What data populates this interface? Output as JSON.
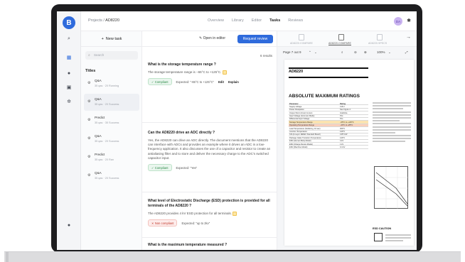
{
  "topbar": {
    "crumb_parent": "Projects",
    "crumb_sep": " / ",
    "crumb_current": "AD8220",
    "tabs": [
      "Overview",
      "Library",
      "Editor",
      "Tasks",
      "Reviews"
    ],
    "active_tab": "Tasks",
    "avatar_initials": "DA"
  },
  "rail": {
    "logo": "B"
  },
  "sidebar": {
    "new_task": "New task",
    "search_placeholder": "Search",
    "title": "Titles",
    "items": [
      {
        "type": "Q&A",
        "meta": "35 qas  ·  20 Running"
      },
      {
        "type": "Q&A",
        "meta": "35 qas  ·  20 Success"
      },
      {
        "type": "Predict",
        "meta": "35 qas  ·  35 Success"
      },
      {
        "type": "Q&A",
        "meta": "35 qas  ·  20 Success"
      },
      {
        "type": "Predict",
        "meta": "35 qas  ·  20 Ran"
      },
      {
        "type": "Q&A",
        "meta": "35 qas  ·  20 Success"
      }
    ]
  },
  "center": {
    "open_editor": "Open in editor",
    "review": "Request review",
    "results": "6 results",
    "qas": [
      {
        "question": "What is the storage temperature range ?",
        "answer": "The storage temperature range is −65°C to +125°C.",
        "status": "Compliant",
        "expected": "Expected: \"-65°C to +125°C\"",
        "edit": "Edit",
        "explain": "Explain"
      },
      {
        "question": "Can the AD8220 drive an ADC directly ?",
        "answer": "Yes, the AD8220 can drive an ADC directly. The document mentions that the AD8220 can interface with ADCs and provides an example where it drives an ADC in a low-frequency application. It also discusses the use of a capacitor and resistor to create an antialiasing filter and to store and deliver the necessary charge to the ADC's switched capacitor input.",
        "status": "Compliant",
        "expected": "Expected: \"Yes\""
      },
      {
        "question": "What level of Electrostatic Discharge (ESD) protection is provided for all terminals of the AD8220 ?",
        "answer": "The AD8220 provides 4 kV ESD protection for all terminals.",
        "status": "Non compliant",
        "expected": "Expected: \"up to 2kv\""
      },
      {
        "question": "What is the maximum temperature measured ?"
      }
    ]
  },
  "viewer": {
    "file_tabs": [
      "AD8220.COMPARE",
      "AD8220.COMPARE",
      "AD8220.SPECS"
    ],
    "page_label": "Page 7 out 9",
    "zoom": "100%",
    "pdf_title": "AD8220",
    "pdf_heading": "ABSOLUTE MAXIMUM RATINGS",
    "table_rows": [
      [
        "Parameter",
        "Rating"
      ],
      [
        "Supply Voltage",
        "±18 V"
      ],
      [
        "Power Dissipation",
        "See Figure 4"
      ],
      [
        "Output Short-Circuit Current",
        "Indefinite"
      ],
      [
        "Input Voltage (Common Mode)",
        "±Vs"
      ],
      [
        "Differential Input Voltage",
        "±Vs"
      ],
      [
        "Storage Temperature Range",
        "−65°C to +125°C"
      ],
      [
        "Operating Temperature Range",
        "−40°C to +85°C"
      ],
      [
        "Lead Temperature (Soldering, 10 sec)",
        "300°C"
      ],
      [
        "Junction Temperature",
        "140°C"
      ],
      [
        "θJA (4-Layer JEDEC Standard Board)",
        "135°C/W"
      ],
      [
        "Package Glass Transition Temperature",
        "140°C"
      ],
      [
        "ESD (Human Body Model)",
        "4 kV"
      ],
      [
        "ESD (Charge Device Model)",
        "1 kV"
      ],
      [
        "ESD (Machine Model)",
        "0.4 kV"
      ]
    ],
    "esd_label": "ESD CAUTION"
  }
}
